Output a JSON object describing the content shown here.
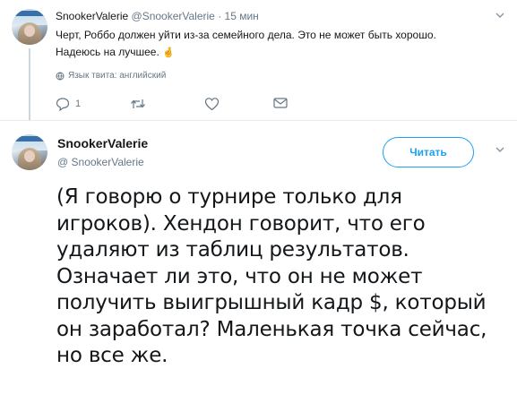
{
  "tweet_reply": {
    "display_name": "SnookerValerie",
    "handle": "@SnookerValerie",
    "separator": "·",
    "time": "15 мин",
    "text_line1": "Черт, Роббо должен уйти из-за семейного дела. Это не может быть хорошо.",
    "text_line2": "Надеюсь на лучшее.",
    "emoji": "🤞",
    "language_label": "Язык твита: английский",
    "reply_count": "1",
    "icons": [
      "reply-icon",
      "retweet-icon",
      "like-icon",
      "direct-message-icon",
      "globe-icon",
      "chevron-down-icon"
    ]
  },
  "tweet_main": {
    "display_name": "SnookerValerie",
    "handle": "@ SnookerValerie",
    "follow_label": "Читать",
    "text": "(Я говорю о турнире только для игроков). Хендон говорит, что его удаляют из таблиц результатов. Означает ли это, что он не может получить выигрышный кадр $, который он заработал? Маленькая точка сейчас, но все же."
  },
  "colors": {
    "accent": "#1da1f2",
    "secondary_text": "#657786",
    "primary_text": "#14171a",
    "divider": "#e6ecf0"
  }
}
